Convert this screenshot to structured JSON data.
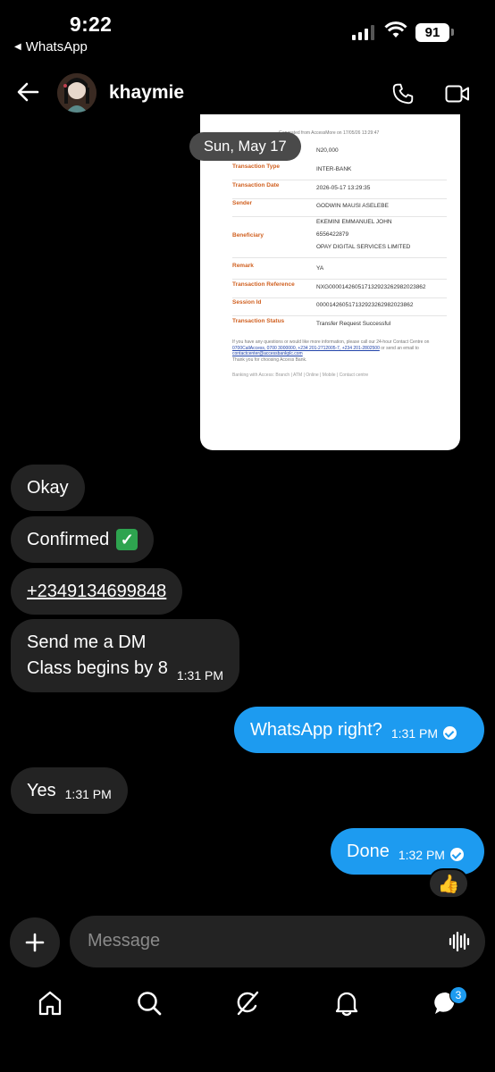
{
  "status": {
    "time": "9:22",
    "back_app": "WhatsApp",
    "battery": "91"
  },
  "header": {
    "name": "khaymie"
  },
  "receipt": {
    "generated": "Generated from AccessMore on 17/05/26 13:29:47",
    "amount": "N20,000",
    "rows": [
      {
        "k": "Transaction Type",
        "v": "INTER-BANK"
      },
      {
        "k": "Transaction Date",
        "v": "2026-05-17 13:29:35"
      },
      {
        "k": "Sender",
        "v": "GODWIN MAUSI ASELEBE"
      },
      {
        "k": "Beneficiary",
        "v1": "EKEMINI EMMANUEL JOHN",
        "v2": "6556422879",
        "v3": "OPAY DIGITAL SERVICES LIMITED"
      },
      {
        "k": "Remark",
        "v": "YA"
      },
      {
        "k": "Transaction Reference",
        "v": "NXG000014260517132923262982023862"
      },
      {
        "k": "Session Id",
        "v": "000014260517132923262982023862"
      },
      {
        "k": "Transaction Status",
        "v": "Transfer Request Successful"
      }
    ],
    "footer1": "If you have any questions or would like more information, please call our 24-hour Contact Centre on",
    "footer_links": "0700CallAccess, 0700 3000000, +234 201-2712005-7, +234 201-2802500",
    "footer_tail": "or send an email to",
    "footer_email": "contactcenter@accessbankplc.com",
    "footer_thanks": "Thank you for choosing Access Bank.",
    "footer2": "Banking with Access: Branch | ATM | Online | Mobile | Contact centre"
  },
  "date_chip": "Sun, May 17",
  "messages": {
    "m1": "Okay",
    "m2": "Confirmed",
    "m3": "+2349134699848",
    "m4_line1": "Send me a DM",
    "m4_line2": "Class begins by 8",
    "m4_time": "1:31 PM",
    "m5": "WhatsApp right?",
    "m5_time": "1:31 PM",
    "m6": "Yes",
    "m6_time": "1:31 PM",
    "m7": "Done",
    "m7_time": "1:32 PM",
    "reaction": "👍"
  },
  "composer": {
    "placeholder": "Message"
  },
  "nav": {
    "badge": "3"
  },
  "colors": {
    "accent": "#1d9bf0",
    "incoming": "#232323",
    "background": "#000000"
  }
}
